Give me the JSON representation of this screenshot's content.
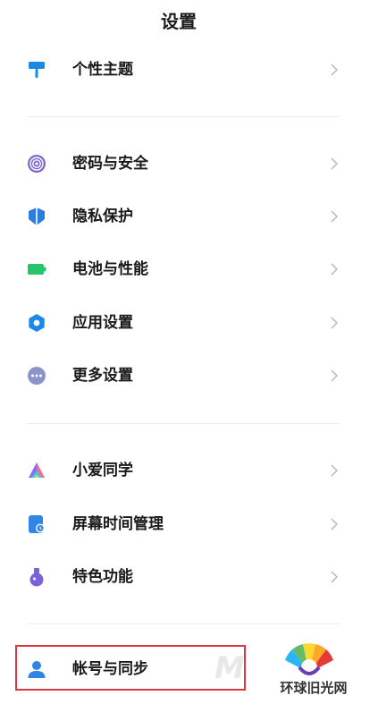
{
  "header": {
    "title": "设置"
  },
  "items": [
    {
      "label": "个性主题",
      "icon": "paint-roller-icon",
      "color": "#1e88e5"
    },
    {
      "label": "密码与安全",
      "icon": "fingerprint-icon",
      "color": "#7b68c9"
    },
    {
      "label": "隐私保护",
      "icon": "privacy-shield-icon",
      "color": "#2a7fdc"
    },
    {
      "label": "电池与性能",
      "icon": "battery-icon",
      "color": "#28c36b"
    },
    {
      "label": "应用设置",
      "icon": "gear-icon",
      "color": "#1e88e5"
    },
    {
      "label": "更多设置",
      "icon": "more-dots-icon",
      "color": "#8a94c9"
    },
    {
      "label": "小爱同学",
      "icon": "xiaoai-icon",
      "color": "#8a6cf0"
    },
    {
      "label": "屏幕时间管理",
      "icon": "screen-time-icon",
      "color": "#2f86e4"
    },
    {
      "label": "特色功能",
      "icon": "flask-icon",
      "color": "#7a62d8"
    },
    {
      "label": "帐号与同步",
      "icon": "account-icon",
      "color": "#2f86e4"
    }
  ],
  "watermark": {
    "text": "环球旧光网"
  },
  "colors": {
    "highlight": "#d63a3a",
    "divider": "#ececec",
    "chevron": "#b8b8b8"
  }
}
